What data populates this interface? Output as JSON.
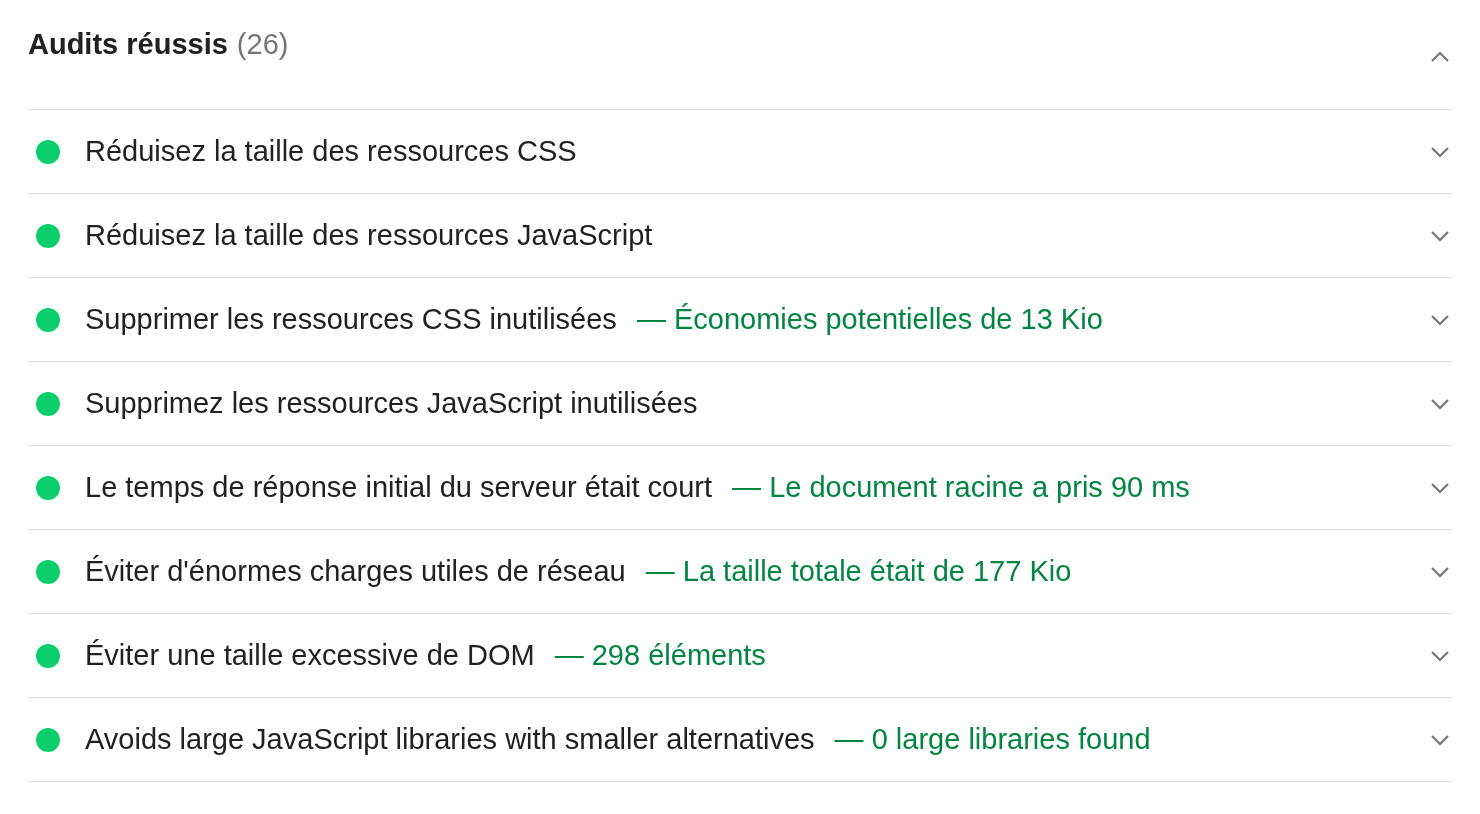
{
  "section": {
    "title": "Audits réussis",
    "count": "(26)",
    "expanded": true
  },
  "audits": [
    {
      "title": "Réduisez la taille des ressources CSS",
      "color": "#0cce6b",
      "expanded": false
    },
    {
      "title": "Réduisez la taille des ressources JavaScript",
      "color": "#0cce6b",
      "expanded": false
    },
    {
      "title": "Supprimer les ressources CSS inutilisées",
      "display_value": "— Économies potentielles de 13 Kio",
      "color": "#0cce6b",
      "expanded": false
    },
    {
      "title": "Supprimez les ressources JavaScript inutilisées",
      "color": "#0cce6b",
      "expanded": false
    },
    {
      "title": "Le temps de réponse initial du serveur était court",
      "display_value": "— Le document racine a pris 90 ms",
      "color": "#0cce6b",
      "expanded": false
    },
    {
      "title": "Éviter d'énormes charges utiles de réseau",
      "display_value": "— La taille totale était de 177 Kio",
      "color": "#0cce6b",
      "expanded": false
    },
    {
      "title": "Éviter une taille excessive de DOM",
      "display_value": "— 298 éléments",
      "color": "#0cce6b",
      "expanded": false
    },
    {
      "title": "Avoids large JavaScript libraries with smaller alternatives",
      "display_value": "— 0 large libraries found",
      "color": "#0cce6b",
      "expanded": false
    }
  ]
}
